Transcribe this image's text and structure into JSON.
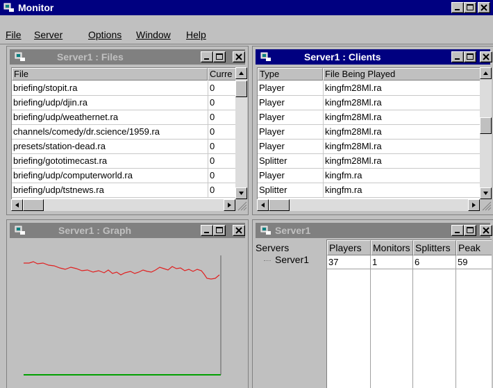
{
  "app": {
    "title": "Monitor"
  },
  "menu": [
    "File",
    "Server",
    "Options",
    "Window",
    "Help"
  ],
  "files_window": {
    "title": "Server1 : Files",
    "columns": [
      "File",
      "Curre"
    ],
    "rows": [
      [
        "briefing/stopit.ra",
        "0"
      ],
      [
        "briefing/udp/djin.ra",
        "0"
      ],
      [
        "briefing/udp/weathernet.ra",
        "0"
      ],
      [
        "channels/comedy/dr.science/1959.ra",
        "0"
      ],
      [
        "presets/station-dead.ra",
        "0"
      ],
      [
        "briefing/gototimecast.ra",
        "0"
      ],
      [
        "briefing/udp/computerworld.ra",
        "0"
      ],
      [
        "briefing/udp/tstnews.ra",
        "0"
      ]
    ]
  },
  "clients_window": {
    "title": "Server1 : Clients",
    "columns": [
      "Type",
      "File Being Played"
    ],
    "rows": [
      [
        "Player",
        "kingfm28Ml.ra"
      ],
      [
        "Player",
        "kingfm28Ml.ra"
      ],
      [
        "Player",
        "kingfm28Ml.ra"
      ],
      [
        "Player",
        "kingfm28Ml.ra"
      ],
      [
        "Player",
        "kingfm28Ml.ra"
      ],
      [
        "Splitter",
        "kingfm28Ml.ra"
      ],
      [
        "Player",
        "kingfm.ra"
      ],
      [
        "Splitter",
        "kingfm.ra"
      ]
    ]
  },
  "graph_window": {
    "title": "Server1 : Graph",
    "colors": {
      "red": "#e02020",
      "green": "#00a000"
    }
  },
  "servers_window": {
    "title": "Server1",
    "columns": [
      "Servers",
      "Players",
      "Monitors",
      "Splitters",
      "Peak"
    ],
    "rows": [
      {
        "name": "Server1",
        "players": "37",
        "monitors": "1",
        "splitters": "6",
        "peak": "59"
      }
    ]
  }
}
